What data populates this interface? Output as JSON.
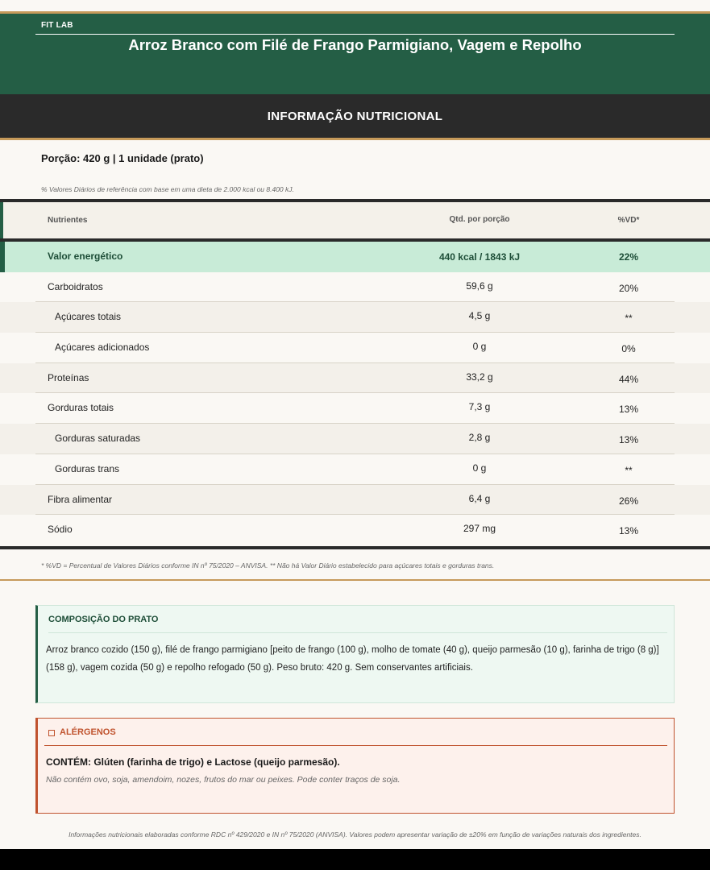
{
  "header": {
    "brand": "FIT LAB",
    "title": "Arroz Branco com Filé de Frango Parmigiano, Vagem e Repolho"
  },
  "section_title": "INFORMAÇÃO NUTRICIONAL",
  "serving": "Porção: 420 g  |  1 unidade (prato)",
  "reference_note": "% Valores Diários de referência com base em uma dieta de 2.000 kcal ou 8.400 kJ.",
  "table": {
    "headers": {
      "nutrient": "Nutrientes",
      "qty": "Qtd. por porção",
      "vd": "%VD*"
    },
    "rows": [
      {
        "name": "Valor energético",
        "qty": "440 kcal / 1843 kJ",
        "vd": "22%"
      },
      {
        "name": "Carboidratos",
        "qty": "59,6 g",
        "vd": "20%"
      },
      {
        "name": "Açúcares totais",
        "qty": "4,5 g",
        "vd": "**"
      },
      {
        "name": "Açúcares adicionados",
        "qty": "0 g",
        "vd": "0%"
      },
      {
        "name": "Proteínas",
        "qty": "33,2 g",
        "vd": "44%"
      },
      {
        "name": "Gorduras totais",
        "qty": "7,3 g",
        "vd": "13%"
      },
      {
        "name": "Gorduras saturadas",
        "qty": "2,8 g",
        "vd": "13%"
      },
      {
        "name": "Gorduras trans",
        "qty": "0 g",
        "vd": "**"
      },
      {
        "name": "Fibra alimentar",
        "qty": "6,4 g",
        "vd": "26%"
      },
      {
        "name": "Sódio",
        "qty": "297 mg",
        "vd": "13%"
      }
    ]
  },
  "footnote": "* %VD = Percentual de Valores Diários conforme IN nº 75/2020 – ANVISA.   ** Não há Valor Diário estabelecido para açúcares totais e gorduras trans.",
  "composition": {
    "title": "COMPOSIÇÃO DO PRATO",
    "text": "Arroz branco cozido (150 g), filé de frango parmigiano [peito de frango (100 g), molho de tomate (40 g), queijo parmesão (10 g), farinha de trigo (8 g)] (158 g), vagem cozida (50 g) e repolho refogado (50 g). Peso bruto: 420 g. Sem conservantes artificiais."
  },
  "allergens": {
    "icon": "warning-icon",
    "title": "ALÉRGENOS",
    "contains": "CONTÉM: Glúten (farinha de trigo) e Lactose (queijo parmesão).",
    "note": "Não contém ovo, soja, amendoim, nozes, frutos do mar ou peixes. Pode conter traços de soja."
  },
  "bottom_note": "Informações nutricionais elaboradas conforme RDC nº 429/2020 e IN nº 75/2020 (ANVISA). Valores podem apresentar variação de ±20% em função de variações naturais dos ingredientes.",
  "colors": {
    "header_green": "#245e45",
    "dark_bar": "#2a2a2a",
    "gold_rule": "#c69a5a",
    "energy_row": "#c8ebd7",
    "allergen_accent": "#c0532e"
  }
}
